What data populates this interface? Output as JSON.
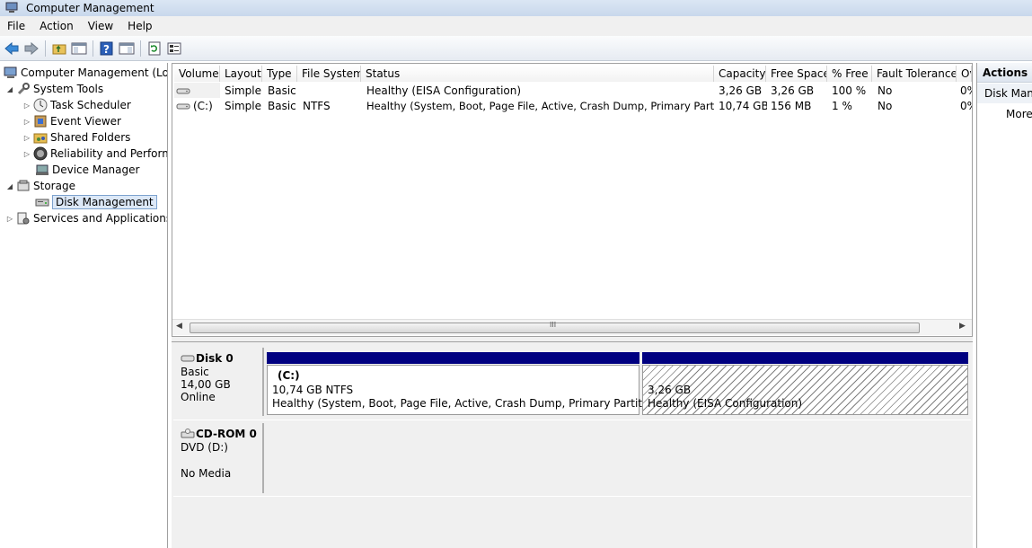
{
  "window": {
    "title": "Computer Management"
  },
  "menu": [
    "File",
    "Action",
    "View",
    "Help"
  ],
  "tree": {
    "root": "Computer Management (Local",
    "system_tools": "System Tools",
    "task_scheduler": "Task Scheduler",
    "event_viewer": "Event Viewer",
    "shared_folders": "Shared Folders",
    "reliability": "Reliability and Performa",
    "device_manager": "Device Manager",
    "storage": "Storage",
    "disk_management": "Disk Management",
    "services": "Services and Applications"
  },
  "volume_table": {
    "headers": [
      "Volume",
      "Layout",
      "Type",
      "File System",
      "Status",
      "Capacity",
      "Free Space",
      "% Free",
      "Fault Tolerance",
      "Ov"
    ],
    "rows": [
      [
        "",
        "Simple",
        "Basic",
        "",
        "Healthy (EISA Configuration)",
        "3,26 GB",
        "3,26 GB",
        "100 %",
        "No",
        "0%"
      ],
      [
        "(C:)",
        "Simple",
        "Basic",
        "NTFS",
        "Healthy (System, Boot, Page File, Active, Crash Dump, Primary Partition)",
        "10,74 GB",
        "156 MB",
        "1 %",
        "No",
        "0%"
      ]
    ]
  },
  "scroll": {
    "grip": "III"
  },
  "disks": [
    {
      "name": "Disk 0",
      "type": "Basic",
      "size": "14,00 GB",
      "status": "Online",
      "partitions": [
        {
          "label": "(C:)",
          "size": "10,74 GB NTFS",
          "status": "Healthy (System, Boot, Page File, Active, Crash Dump, Primary Partition)"
        },
        {
          "label": "",
          "size": "3,26 GB",
          "status": "Healthy (EISA Configuration)"
        }
      ]
    },
    {
      "name": "CD-ROM 0",
      "type": "DVD (D:)",
      "status": "No Media"
    }
  ],
  "actions": {
    "title": "Actions",
    "section": "Disk Management",
    "more": "More"
  }
}
